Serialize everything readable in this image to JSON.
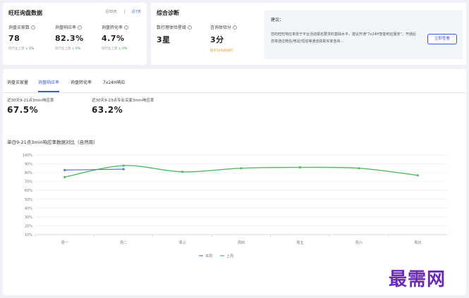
{
  "inquiry_card": {
    "title": "旺旺询盘数据",
    "period_tabs": [
      "近30天",
      "近7天"
    ],
    "metrics": [
      {
        "label": "询盘买家数",
        "value": "78",
        "compare": "较行业上周",
        "trend": "↓ 0%"
      },
      {
        "label": "询盘响应率",
        "value": "82.3%",
        "compare": "较行业上周",
        "trend": "↓ 0%"
      },
      {
        "label": "询盘转化率",
        "value": "4.7%",
        "compare": "较行业上周",
        "trend": "↓ 0%"
      }
    ]
  },
  "diagnosis_card": {
    "title": "综合诊断",
    "metrics": [
      {
        "label": "数打理体验星级",
        "value": "3星",
        "compare": ""
      },
      {
        "label": "咨询体验分",
        "value": "3分",
        "compare": "低于50%的同行"
      }
    ],
    "advice": {
      "title": "建议：",
      "text": "您的旺旺响应率低于平台活动报名要求的基础水平，建议开通\"7x24H智能响应服务\"，开通后您将通过微信/电话/短信等通道获取买家咨询...",
      "button": "立即查看"
    }
  },
  "main_card": {
    "tabs": [
      "询盘买家量",
      "询盘响应率",
      "询盘转化率",
      "7x24H响应"
    ],
    "active_tab": 1,
    "stats": [
      {
        "label": "近30天9-21点3min响应率",
        "value": "67.5%"
      },
      {
        "label": "近30天9-23点专业买家3min响应率",
        "value": "63.2%"
      }
    ],
    "chart_title": "单日9-21点3min响应率数据对比（自然周）"
  },
  "colors": {
    "accent": "#3a5bd9",
    "this_week": "#4a7fd6",
    "last_week": "#57b865"
  },
  "chart_data": {
    "type": "line",
    "categories": [
      "周一",
      "周二",
      "周三",
      "周四",
      "周五",
      "周六",
      "周日"
    ],
    "y_ticks": [
      "10%",
      "20%",
      "30%",
      "40%",
      "50%",
      "60%",
      "70%",
      "80%",
      "90%",
      "100%"
    ],
    "ylim": [
      10,
      100
    ],
    "grid": true,
    "legend_position": "bottom",
    "series": [
      {
        "name": "本周",
        "values": [
          83,
          84,
          null,
          null,
          null,
          null,
          null
        ]
      },
      {
        "name": "上周",
        "values": [
          75,
          88,
          81,
          85,
          86,
          85,
          77
        ]
      }
    ]
  },
  "watermark": "最需网"
}
